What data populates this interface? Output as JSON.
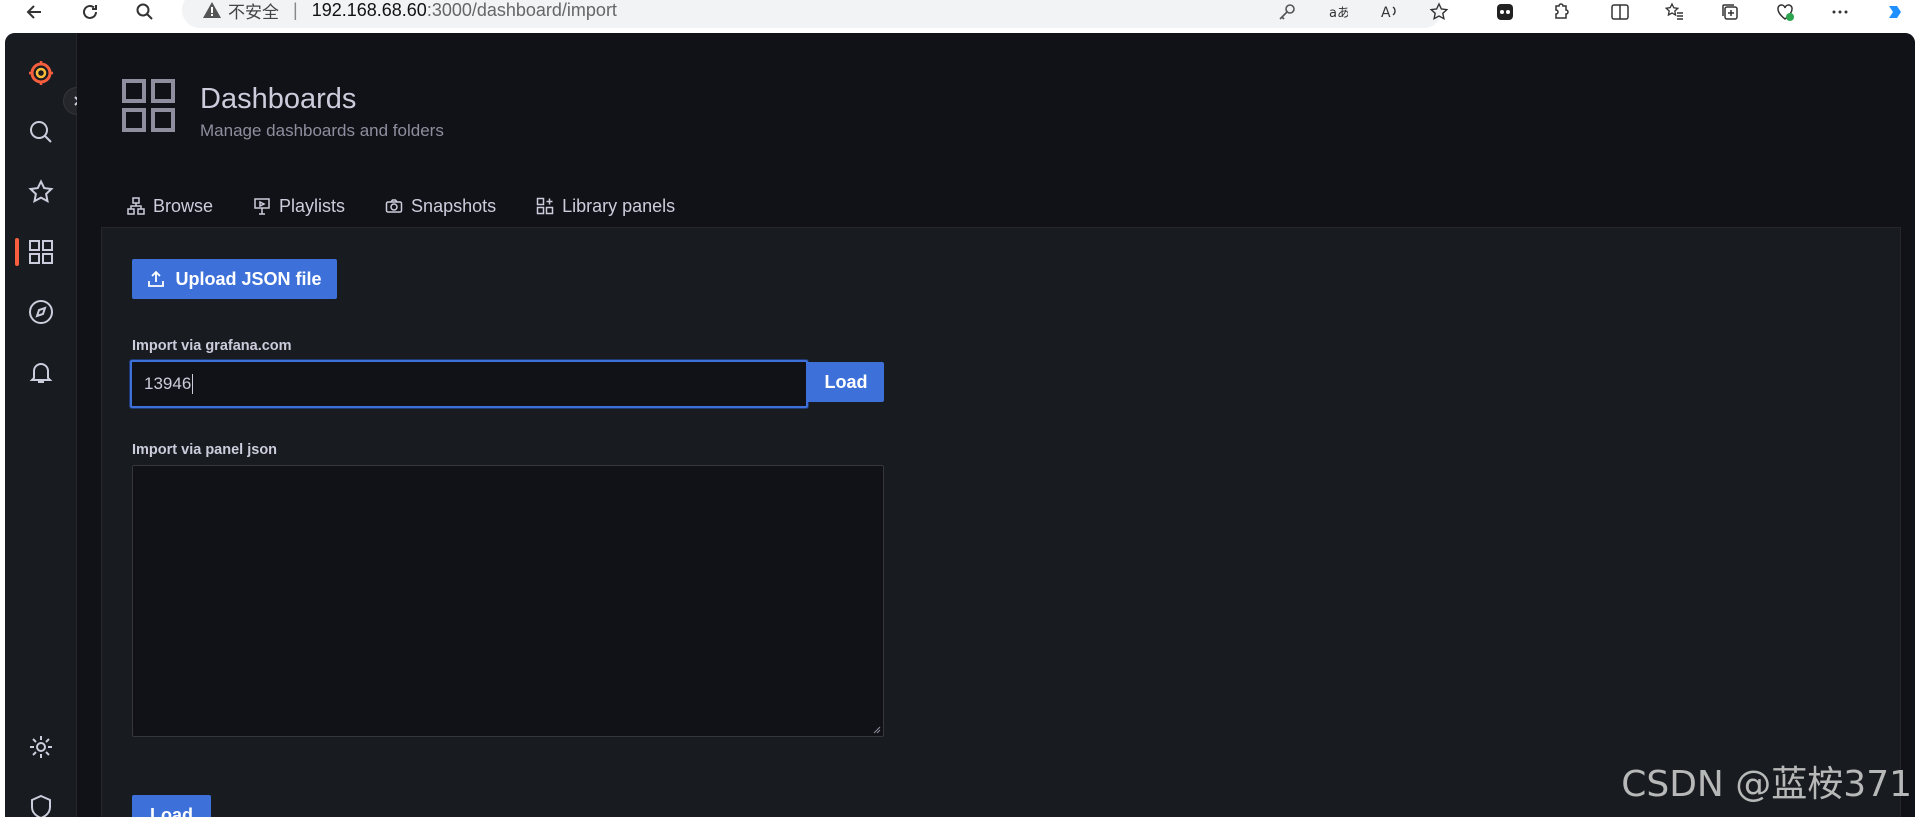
{
  "browser": {
    "security_label": "不安全",
    "url_host": "192.168.68.60",
    "url_path": ":3000/dashboard/import"
  },
  "header": {
    "title": "Dashboards",
    "subtitle": "Manage dashboards and folders"
  },
  "tabs": [
    {
      "label": "Browse",
      "icon": "sitemap-icon"
    },
    {
      "label": "Playlists",
      "icon": "presentation-icon"
    },
    {
      "label": "Snapshots",
      "icon": "camera-icon"
    },
    {
      "label": "Library panels",
      "icon": "library-panel-icon"
    }
  ],
  "import": {
    "upload_label": "Upload JSON file",
    "grafana_label": "Import via grafana.com",
    "grafana_value": "13946",
    "load_label": "Load",
    "panel_json_label": "Import via panel json",
    "panel_json_value": "",
    "load_bottom_label": "Load"
  },
  "sidemenu": {
    "items": [
      "grafana-logo-icon",
      "search-icon",
      "star-icon",
      "dashboards-icon",
      "compass-icon",
      "bell-icon",
      "gear-icon",
      "shield-icon"
    ],
    "active": "dashboards-icon"
  },
  "colors": {
    "primary": "#3d71d9",
    "background": "#111217",
    "panel": "#181b1f",
    "text": "#ccccdc",
    "brand": "#f55f3e"
  },
  "watermark": "CSDN @蓝桉371"
}
